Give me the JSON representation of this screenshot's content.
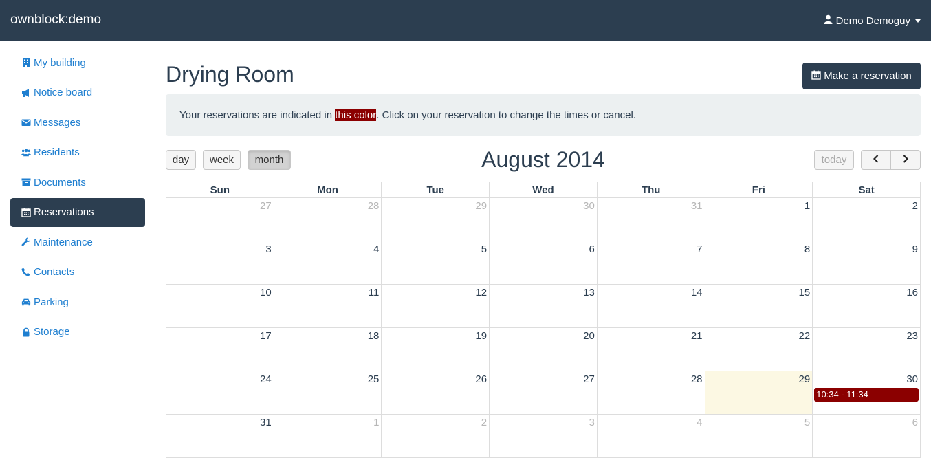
{
  "app": {
    "brand": "ownblock:demo",
    "user": "Demo Demoguy"
  },
  "sidebar": {
    "items": [
      {
        "label": "My building",
        "icon": "building-icon",
        "active": false
      },
      {
        "label": "Notice board",
        "icon": "bullhorn-icon",
        "active": false
      },
      {
        "label": "Messages",
        "icon": "envelope-icon",
        "active": false
      },
      {
        "label": "Residents",
        "icon": "users-icon",
        "active": false
      },
      {
        "label": "Documents",
        "icon": "archive-icon",
        "active": false
      },
      {
        "label": "Reservations",
        "icon": "calendar-icon",
        "active": true
      },
      {
        "label": "Maintenance",
        "icon": "wrench-icon",
        "active": false
      },
      {
        "label": "Contacts",
        "icon": "phone-icon",
        "active": false
      },
      {
        "label": "Parking",
        "icon": "car-icon",
        "active": false
      },
      {
        "label": "Storage",
        "icon": "lock-icon",
        "active": false
      }
    ]
  },
  "page": {
    "title": "Drying Room",
    "reserve_button": "Make a reservation",
    "alert": {
      "before": "Your reservations are indicated in ",
      "highlight": "this color",
      "after": ". Click on your reservation to change the times or cancel."
    }
  },
  "calendar": {
    "title": "August 2014",
    "views": [
      "day",
      "week",
      "month"
    ],
    "active_view": "month",
    "today_label": "today",
    "weekdays": [
      "Sun",
      "Mon",
      "Tue",
      "Wed",
      "Thu",
      "Fri",
      "Sat"
    ],
    "weeks": [
      [
        {
          "d": "27",
          "o": true
        },
        {
          "d": "28",
          "o": true
        },
        {
          "d": "29",
          "o": true
        },
        {
          "d": "30",
          "o": true
        },
        {
          "d": "31",
          "o": true
        },
        {
          "d": "1"
        },
        {
          "d": "2"
        }
      ],
      [
        {
          "d": "3"
        },
        {
          "d": "4"
        },
        {
          "d": "5"
        },
        {
          "d": "6"
        },
        {
          "d": "7"
        },
        {
          "d": "8"
        },
        {
          "d": "9"
        }
      ],
      [
        {
          "d": "10"
        },
        {
          "d": "11"
        },
        {
          "d": "12"
        },
        {
          "d": "13"
        },
        {
          "d": "14"
        },
        {
          "d": "15"
        },
        {
          "d": "16"
        }
      ],
      [
        {
          "d": "17"
        },
        {
          "d": "18"
        },
        {
          "d": "19"
        },
        {
          "d": "20"
        },
        {
          "d": "21"
        },
        {
          "d": "22"
        },
        {
          "d": "23"
        }
      ],
      [
        {
          "d": "24"
        },
        {
          "d": "25"
        },
        {
          "d": "26"
        },
        {
          "d": "27"
        },
        {
          "d": "28"
        },
        {
          "d": "29",
          "today": true
        },
        {
          "d": "30",
          "event": "10:34 - 11:34"
        }
      ],
      [
        {
          "d": "31"
        },
        {
          "d": "1",
          "o": true
        },
        {
          "d": "2",
          "o": true
        },
        {
          "d": "3",
          "o": true
        },
        {
          "d": "4",
          "o": true
        },
        {
          "d": "5",
          "o": true
        },
        {
          "d": "6",
          "o": true
        }
      ]
    ]
  },
  "colors": {
    "navbar": "#2c3e50",
    "link": "#1f7fd0",
    "reservation": "#8b0000",
    "today": "#fcf8e3"
  }
}
